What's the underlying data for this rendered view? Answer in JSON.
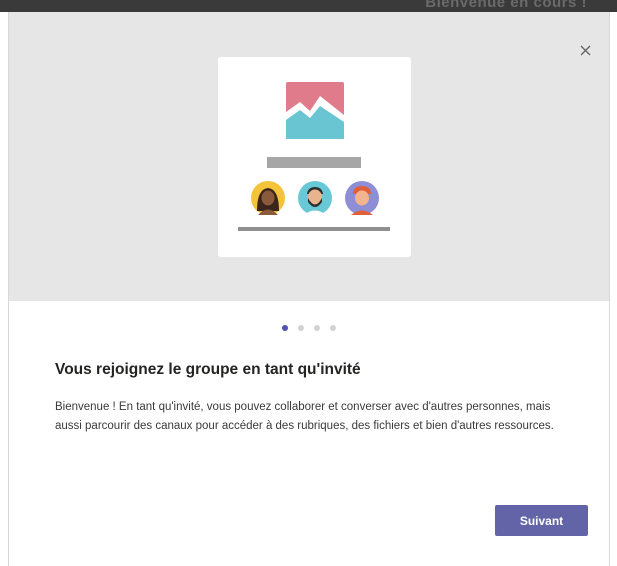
{
  "background_header": {
    "text": "Bienvenue en cours !"
  },
  "dialog": {
    "title": "Vous rejoignez le groupe en tant qu'invité",
    "body": "Bienvenue ! En tant qu'invité, vous pouvez collaborer et converser avec d'autres personnes, mais aussi parcourir des canaux pour accéder à des rubriques, des fichiers et bien d'autres ressources.",
    "next_label": "Suivant",
    "close_icon": "close-icon",
    "pager": {
      "total": 4,
      "current": 1
    }
  },
  "colors": {
    "accent": "#6264a7",
    "pager_active": "#4f52b2",
    "hero_background": "#e6e6e6",
    "image_pink": "#e07b8c",
    "image_teal": "#6ac5d3"
  }
}
